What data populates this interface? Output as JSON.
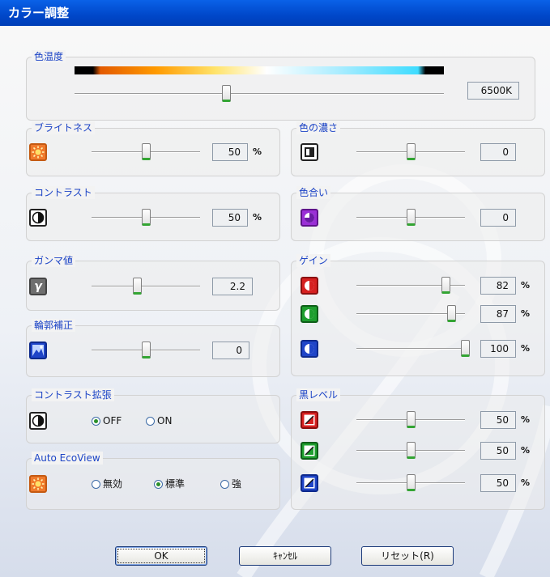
{
  "window": {
    "title": "カラー調整"
  },
  "color_temp": {
    "label": "色温度",
    "value": "6500K",
    "level": 0.41
  },
  "brightness": {
    "label": "ブライトネス",
    "value": "50",
    "unit": "%",
    "level": 0.5,
    "icon": "brightness-sun-icon"
  },
  "contrast": {
    "label": "コントラスト",
    "value": "50",
    "unit": "%",
    "level": 0.5,
    "icon": "contrast-icon"
  },
  "saturation": {
    "label": "色の濃さ",
    "value": "0",
    "level": 0.5,
    "icon": "saturation-icon"
  },
  "hue": {
    "label": "色合い",
    "value": "0",
    "level": 0.5,
    "icon": "hue-icon"
  },
  "gamma": {
    "label": "ガンマ値",
    "value": "2.2",
    "level": 0.42,
    "icon": "gamma-icon"
  },
  "sharpness": {
    "label": "輪郭補正",
    "value": "0",
    "level": 0.5,
    "icon": "sharpness-icon"
  },
  "gain": {
    "label": "ゲイン",
    "unit": "%",
    "channels": [
      {
        "name": "red",
        "value": "82",
        "level": 0.82,
        "color": "#D62020",
        "icon": "red-gain-icon"
      },
      {
        "name": "green",
        "value": "87",
        "level": 0.87,
        "color": "#1E9E2E",
        "icon": "green-gain-icon"
      },
      {
        "name": "blue",
        "value": "100",
        "level": 1.0,
        "color": "#1F45C8",
        "icon": "blue-gain-icon"
      }
    ]
  },
  "contrast_expansion": {
    "label": "コントラスト拡張",
    "options": [
      "OFF",
      "ON"
    ],
    "selected": "OFF",
    "icon": "contrast-expansion-icon"
  },
  "black_level": {
    "label": "黒レベル",
    "unit": "%",
    "channels": [
      {
        "name": "red",
        "value": "50",
        "level": 0.5,
        "color": "#D62020",
        "icon": "red-black-level-icon"
      },
      {
        "name": "green",
        "value": "50",
        "level": 0.5,
        "color": "#1E9E2E",
        "icon": "green-black-level-icon"
      },
      {
        "name": "blue",
        "value": "50",
        "level": 0.5,
        "color": "#1F45C8",
        "icon": "blue-black-level-icon"
      }
    ]
  },
  "auto_ecoview": {
    "label": "Auto EcoView",
    "options": [
      "無効",
      "標準",
      "強"
    ],
    "selected": "標準",
    "icon": "ecoview-sun-icon"
  },
  "buttons": {
    "ok": "OK",
    "cancel": "ｷｬﾝｾﾙ",
    "reset": "リセット(R)"
  },
  "colors": {
    "title_bar": "#0054E3",
    "group_label": "#1C44C6",
    "slider_thumb_accent": "#33A533"
  }
}
